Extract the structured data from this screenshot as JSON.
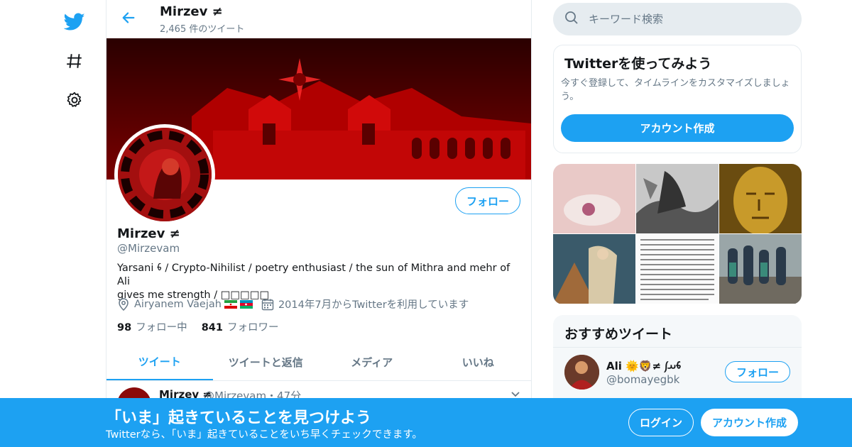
{
  "colors": {
    "accent": "#1da1f2",
    "muted": "#657786",
    "border": "#e6ecf0"
  },
  "nav": {
    "icons": [
      "twitter-logo-icon",
      "hashtag-icon",
      "gear-icon"
    ]
  },
  "header": {
    "name": "Mirzev ≠",
    "tweet_count": "2,465 件のツイート"
  },
  "profile": {
    "follow_label": "フォロー",
    "name": "Mirzev ≠",
    "handle": "@Mirzevam",
    "bio_line1": "Yarsani 𐬨 / Crypto-Nihilist / poetry enthusiast / the sun of Mithra and mehr of Ali",
    "bio_line2": "gives me strength / □□□□□",
    "location": "Airyanem Vaejah",
    "joined": "2014年7月からTwitterを利用しています",
    "following_count": "98",
    "following_label": "フォロー中",
    "followers_count": "841",
    "followers_label": "フォロワー"
  },
  "tabs": [
    {
      "label": "ツイート",
      "active": true
    },
    {
      "label": "ツイートと返信",
      "active": false
    },
    {
      "label": "メディア",
      "active": false
    },
    {
      "label": "いいね",
      "active": false
    }
  ],
  "tweet": {
    "name": "Mirzev ≠",
    "handle_time": "@Mirzevam・47分"
  },
  "search": {
    "placeholder": "キーワード検索"
  },
  "try_box": {
    "title": "Twitterを使ってみよう",
    "description": "今すぐ登録して、タイムラインをカスタマイズしましょう。",
    "signup_label": "アカウント作成"
  },
  "recommended": {
    "title": "おすすめツイート",
    "name": "Ali 🌞🦁≠ 𐬨𐬀𐬰",
    "handle": "@bomayegbk",
    "follow_label": "フォロー"
  },
  "bottom_bar": {
    "headline": "「いま」起きていることを見つけよう",
    "subtext": "Twitterなら、「いま」起きていることをいち早くチェックできます。",
    "login_label": "ログイン",
    "signup_label": "アカウント作成"
  }
}
